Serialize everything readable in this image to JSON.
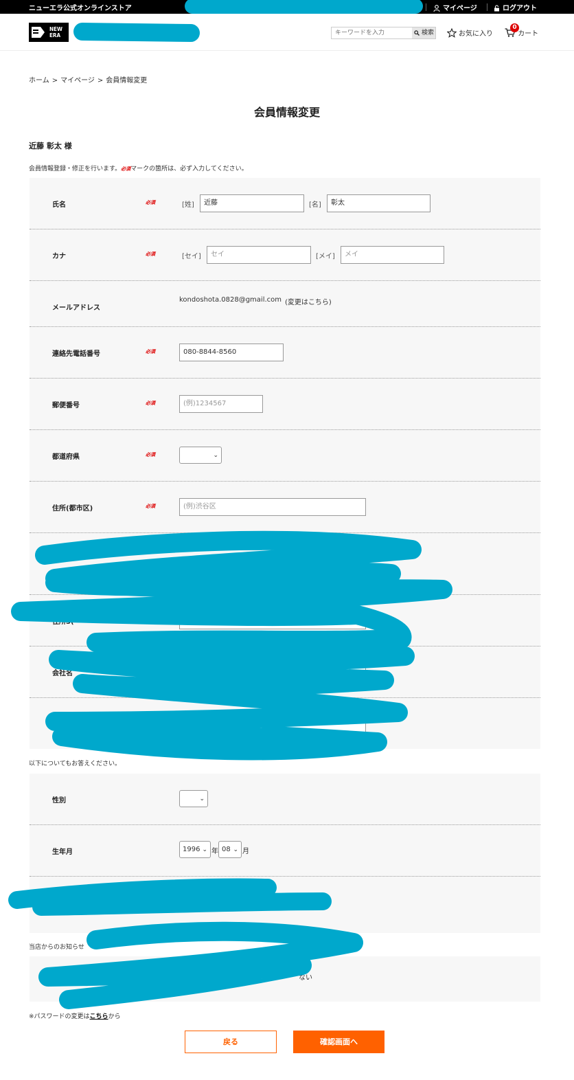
{
  "topbar": {
    "store_name": "ニューエラ公式オンラインストア",
    "mypage": "マイページ",
    "logout": "ログアウト"
  },
  "header": {
    "logo_line1": "NEW",
    "logo_line2": "ERA",
    "search_placeholder": "キーワードを入力",
    "search_button": "検索",
    "favorites": "お気に入り",
    "cart_label": "カート",
    "cart_count": "0"
  },
  "breadcrumb": [
    "ホーム",
    ">",
    "マイページ",
    ">",
    "会員情報変更"
  ],
  "page_title": "会員情報変更",
  "user_name": "近藤 彰太 様",
  "intro": {
    "before": "会員情報登録・修正を行います。",
    "required_mark": "必須",
    "after": "マークの箇所は、必ず入力してください。"
  },
  "form": {
    "name": {
      "label": "氏名",
      "last_tag": "[姓]",
      "last_value": "近藤",
      "first_tag": "[名]",
      "first_value": "彰太"
    },
    "kana": {
      "label": "カナ",
      "last_tag": "[セイ]",
      "last_placeholder": "セイ",
      "first_tag": "[メイ]",
      "first_placeholder": "メイ"
    },
    "email": {
      "label": "メールアドレス",
      "value": "kondoshota.0828@gmail.com",
      "change": "(変更はこちら)"
    },
    "phone": {
      "label": "連絡先電話番号",
      "value": "080-8844-8560"
    },
    "zip": {
      "label": "郵便番号",
      "placeholder": "(例)1234567"
    },
    "prefecture": {
      "label": "都道府県",
      "value": ""
    },
    "city": {
      "label": "住所(都市区)",
      "placeholder": "(例)渋谷区"
    },
    "company": {
      "label": "会社名"
    },
    "address3_partial": "住所3("
  },
  "extra_heading": "以下についてもお答えください。",
  "gender": {
    "label": "性別",
    "value": ""
  },
  "birth": {
    "label": "生年月",
    "year": "1996",
    "year_unit": "年",
    "month": "08",
    "month_unit": "月"
  },
  "newsletter_partial": "当店からのお知らせ",
  "newsletter_tail": "ない",
  "password_note": {
    "before": "※パスワードの変更は",
    "link": "こちら",
    "after": "から"
  },
  "buttons": {
    "back": "戻る",
    "confirm": "確認画面へ"
  },
  "colors": {
    "accent": "#ff6100",
    "required": "#dd0000",
    "redaction": "#00a8cc"
  }
}
